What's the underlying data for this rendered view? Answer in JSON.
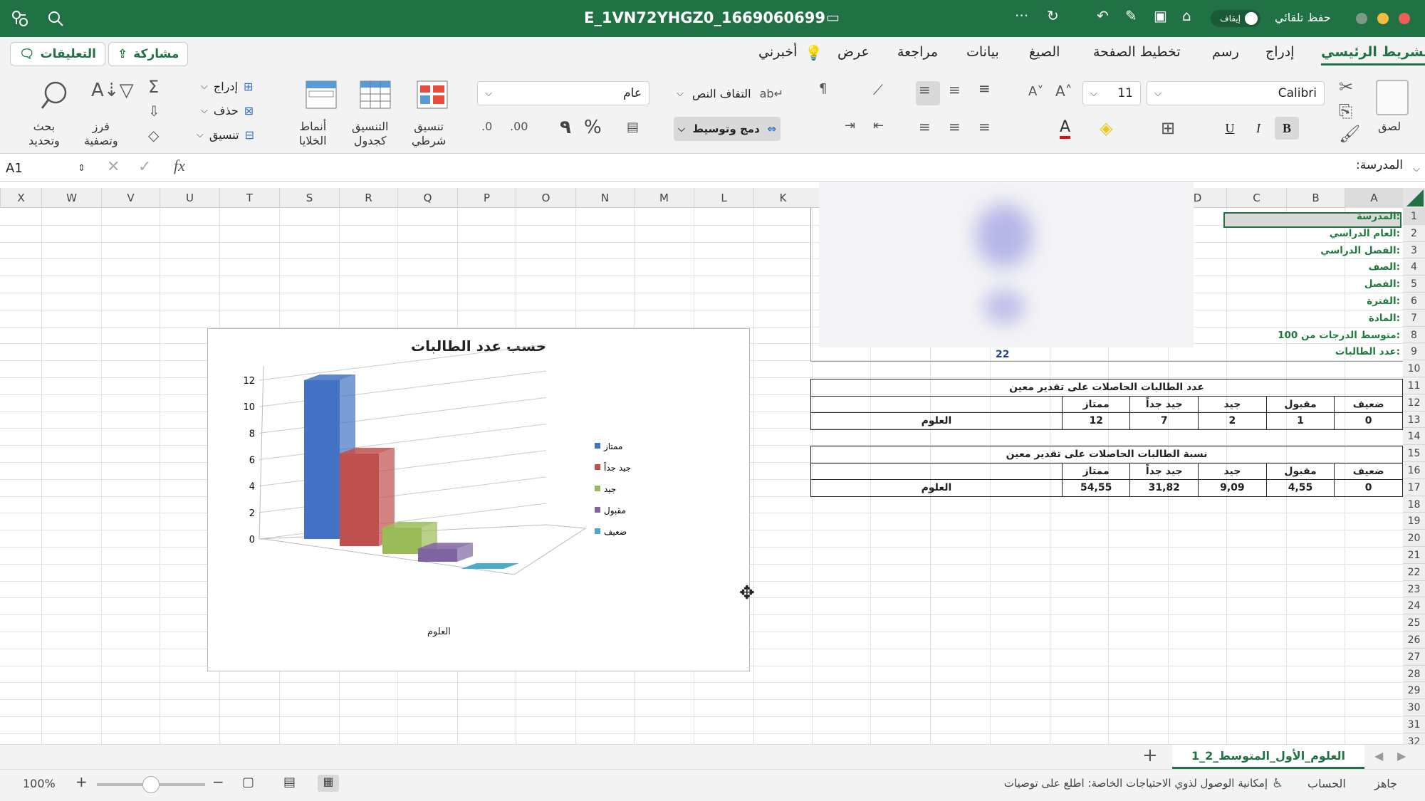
{
  "window": {
    "filename": "E_1VN72YHGZ0_1669060699",
    "autosave_label": "حفظ تلقائي",
    "autosave_state": "إيقاف"
  },
  "ribbon_tabs": [
    "الشريط الرئيسي",
    "إدراج",
    "رسم",
    "تخطيط الصفحة",
    "الصيغ",
    "بيانات",
    "مراجعة",
    "عرض",
    "أخبرني"
  ],
  "share_label": "مشاركة",
  "comments_label": "التعليقات",
  "ribbon": {
    "paste": "لصق",
    "font_name": "Calibri",
    "font_size": "11",
    "bold": "B",
    "italic": "I",
    "underline": "U",
    "wrap_text": "التفاف النص",
    "merge_center": "دمج وتوسيط",
    "number_format": "عام",
    "cond_format": [
      "تنسيق",
      "شرطي"
    ],
    "table_format": [
      "التنسيق",
      "كجدول"
    ],
    "cell_styles": [
      "أنماط",
      "الخلايا"
    ],
    "insert": "إدراج",
    "delete": "حذف",
    "format": "تنسيق",
    "sort_filter": [
      "فرز",
      "وتصفية"
    ],
    "find_select": [
      "بحث",
      "وتحديد"
    ],
    "percent": "%",
    "comma": "٩"
  },
  "formula_bar": {
    "name_box": "A1",
    "fx": "fx",
    "content": "المدرسة:"
  },
  "columns": [
    "A",
    "B",
    "C",
    "D",
    "K",
    "L",
    "M",
    "N",
    "O",
    "P",
    "Q",
    "R",
    "S",
    "T",
    "U",
    "V",
    "W",
    "X"
  ],
  "rows": [
    "1",
    "2",
    "3",
    "4",
    "5",
    "6",
    "7",
    "8",
    "9",
    "10",
    "11",
    "12",
    "13",
    "14",
    "15",
    "16",
    "17",
    "18",
    "19",
    "20",
    "21",
    "22",
    "23",
    "24",
    "25",
    "26",
    "27",
    "28",
    "29",
    "30",
    "31",
    "32"
  ],
  "labels": [
    "المدرسة:",
    "العام الدراسي:",
    "الفصل الدراسي:",
    "الصف:",
    "الفصل:",
    "الفترة:",
    "المادة:",
    "متوسط الدرجات من 100:",
    "عدد الطالبات:"
  ],
  "student_count": "22",
  "table1": {
    "title": "عدد الطالبات الحاصلات على تقدير معين",
    "headers": [
      "ممتاز",
      "جيد جداً",
      "جيد",
      "مقبول",
      "ضعيف"
    ],
    "subject": "العلوم",
    "values": [
      "12",
      "7",
      "2",
      "1",
      "0"
    ]
  },
  "table2": {
    "title": "نسبة الطالبات الحاصلات على تقدير معين",
    "headers": [
      "ممتاز",
      "جيد جداً",
      "جيد",
      "مقبول",
      "ضعيف"
    ],
    "subject": "العلوم",
    "values": [
      "54,55",
      "31,82",
      "9,09",
      "4,55",
      "0"
    ]
  },
  "chart_data": {
    "type": "bar",
    "title": "حسب عدد الطالبات",
    "categories": [
      "العلوم"
    ],
    "series": [
      {
        "name": "ممتاز",
        "values": [
          12
        ],
        "color": "#4472c4"
      },
      {
        "name": "جيد جداً",
        "values": [
          7
        ],
        "color": "#c0504d"
      },
      {
        "name": "جيد",
        "values": [
          2
        ],
        "color": "#9bbb59"
      },
      {
        "name": "مقبول",
        "values": [
          1
        ],
        "color": "#8064a2"
      },
      {
        "name": "ضعيف",
        "values": [
          0
        ],
        "color": "#4bacc6"
      }
    ],
    "yticks": [
      "0",
      "2",
      "4",
      "6",
      "8",
      "10",
      "12"
    ],
    "ylim": [
      0,
      12
    ],
    "legend": "right",
    "grid": true
  },
  "sheet_tab": "العلوم_الأول_المتوسط_2_1",
  "status": {
    "ready": "جاهز",
    "account": "الحساب",
    "accessibility": "إمكانية الوصول لذوي الاحتياجات الخاصة: اطلع على توصيات",
    "zoom": "100%"
  },
  "colors": {
    "accent": "#207245"
  }
}
